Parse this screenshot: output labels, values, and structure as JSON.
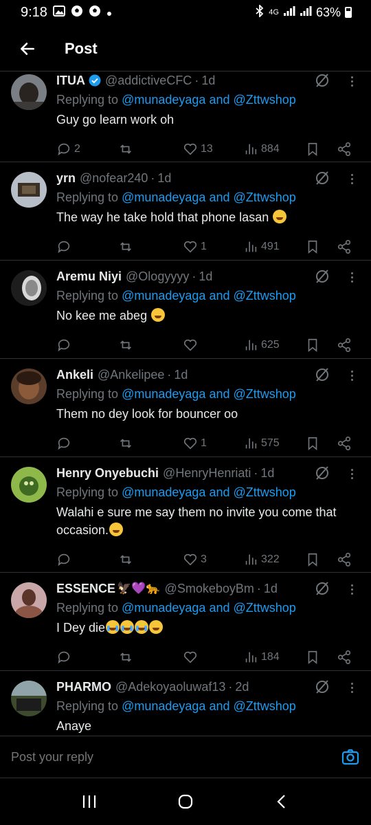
{
  "status": {
    "time": "9:18",
    "network": "4G",
    "battery": "63%"
  },
  "header": {
    "title": "Post"
  },
  "tweets": [
    {
      "name": "ITUA",
      "verified": true,
      "handle": "@addictiveCFC",
      "time": "1d",
      "replying_prefix": "Replying to",
      "mention1": "@munadeyaga",
      "and": "and",
      "mention2": "@Zttwshop",
      "text": "Guy go learn work oh",
      "emoji": "",
      "replies": "2",
      "reposts": "",
      "likes": "13",
      "views": "884"
    },
    {
      "name": "yrn",
      "verified": false,
      "handle": "@nofear240",
      "time": "1d",
      "replying_prefix": "Replying to",
      "mention1": "@munadeyaga",
      "and": "and",
      "mention2": "@Zttwshop",
      "text": "The way he take hold that phone lasan",
      "emoji": "laugh",
      "replies": "",
      "reposts": "",
      "likes": "1",
      "views": "491"
    },
    {
      "name": "Aremu Niyi",
      "verified": false,
      "handle": "@Ologyyyy",
      "time": "1d",
      "replying_prefix": "Replying to",
      "mention1": "@munadeyaga",
      "and": "and",
      "mention2": "@Zttwshop",
      "text": "No kee me abeg",
      "emoji": "rofl",
      "replies": "",
      "reposts": "",
      "likes": "",
      "views": "625"
    },
    {
      "name": "Ankeli",
      "verified": false,
      "handle": "@Ankelipee",
      "time": "1d",
      "replying_prefix": "Replying to",
      "mention1": "@munadeyaga",
      "and": "and",
      "mention2": "@Zttwshop",
      "text": "Them no dey look for bouncer oo",
      "emoji": "",
      "replies": "",
      "reposts": "",
      "likes": "1",
      "views": "575"
    },
    {
      "name": "Henry Onyebuchi",
      "verified": false,
      "handle": "@HenryHenriati",
      "time": "1d",
      "replying_prefix": "Replying to",
      "mention1": "@munadeyaga",
      "and": "and",
      "mention2": "@Zttwshop",
      "text": "Walahi e sure me say them no invite you come that occasion.",
      "emoji": "rofl",
      "replies": "",
      "reposts": "",
      "likes": "3",
      "views": "322"
    },
    {
      "name": "ESSENCE",
      "name_emojis": "🦅💜🐆",
      "verified": false,
      "handle": "@SmokeboyBm",
      "time": "1d",
      "replying_prefix": "Replying to",
      "mention1": "@munadeyaga",
      "and": "and",
      "mention2": "@Zttwshop",
      "text": "I Dey die",
      "emoji": "cry3laugh",
      "replies": "",
      "reposts": "",
      "likes": "",
      "views": "184"
    },
    {
      "name": "PHARMO",
      "verified": false,
      "handle": "@Adekoyaoluwaf13",
      "time": "2d",
      "replying_prefix": "Replying to",
      "mention1": "@munadeyaga",
      "and": "and",
      "mention2": "@Zttwshop",
      "text": "Anaye",
      "emoji": "",
      "replies": "",
      "reposts": "",
      "likes": "",
      "views": ""
    }
  ],
  "reply": {
    "placeholder": "Post your reply"
  },
  "colors": {
    "background": "#000000",
    "accent": "#1d9bf0",
    "muted": "#71767b",
    "divider": "#2f3336"
  }
}
